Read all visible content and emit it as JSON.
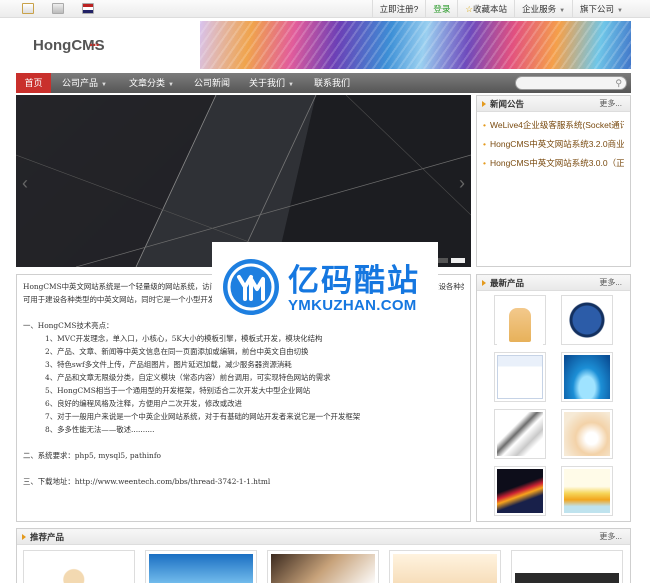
{
  "topbar": {
    "icons": [
      "home-icon",
      "monitor-icon",
      "flag-icon"
    ],
    "links": [
      {
        "label": "立即注册?",
        "color": "#333333"
      },
      {
        "label": "登录",
        "color": "#2a9a2a"
      },
      {
        "label": "收藏本站",
        "color": "#333333"
      },
      {
        "label": "企业服务",
        "dropdown": true
      },
      {
        "label": "旗下公司",
        "dropdown": true
      }
    ]
  },
  "header": {
    "logo_dots": "...",
    "logo_text": "HongCMS"
  },
  "nav": {
    "items": [
      {
        "label": "首页",
        "active": true
      },
      {
        "label": "公司产品",
        "dropdown": true
      },
      {
        "label": "文章分类",
        "dropdown": true
      },
      {
        "label": "公司新闻"
      },
      {
        "label": "关于我们",
        "dropdown": true
      },
      {
        "label": "联系我们"
      }
    ],
    "search_placeholder": ""
  },
  "slider": {
    "prev_icon": "chevron-left-icon",
    "next_icon": "chevron-right-icon",
    "dot_count": 2,
    "active_dot": 2
  },
  "news": {
    "title": "新闻公告",
    "more": "更多...",
    "items": [
      "WeLive4企业级客服系统(Socket通讯技",
      "HongCMS中英文网站系统3.2.0商业版发",
      "HongCMS中英文网站系统3.0.0（正式"
    ]
  },
  "intro": {
    "lines": [
      {
        "text": "HongCMS中英文网站系统是一个轻量级的网站系统，访问速度极快，使用简单。程序代码简洁严谨，完全免费开源。可用于建设各种类型的中英文网站，同时它是一个小型开发框架。",
        "indent": false
      },
      {
        "text": "可用于建设各种类型的中英文网站，同时它是一个小型开发框架。",
        "indent": false
      },
      {
        "text": "",
        "indent": false
      },
      {
        "text": "一、HongCMS技术亮点：",
        "indent": false
      },
      {
        "text": "1、MVC开发理念，单入口，小核心，5K大小的模板引擎，模板式开发，模块化结构",
        "indent": true
      },
      {
        "text": "2、产品、文章、新闻等中英文信息在同一页面添加或编辑，前台中英文自由切换",
        "indent": true
      },
      {
        "text": "3、特色swf多文件上传，产品组图片，图片延迟加载，减少服务器资源消耗",
        "indent": true
      },
      {
        "text": "4、产品和文章无限级分类，自定义模块（常态内容）前台调用，可实现特色网站的需求",
        "indent": true
      },
      {
        "text": "5、HongCMS相当于一个通用型的开发框架，特别适合二次开发大中型企业网站",
        "indent": true
      },
      {
        "text": "6、良好的编程风格及注释，方便用户二次开发，修改或改进",
        "indent": true
      },
      {
        "text": "7、对于一般用户来说是一个中英企业网站系统，对于有基础的网站开发者来说它是一个开发框架",
        "indent": true
      },
      {
        "text": "8、多多性能无法——敬述..........",
        "indent": true
      },
      {
        "text": "",
        "indent": false
      },
      {
        "text": "二、系统要求：php5, mysql5, pathinfo",
        "indent": false
      },
      {
        "text": "",
        "indent": false
      },
      {
        "text": "三、下载地址：http://www.weentech.com/bbs/thread-3742-1-1.html",
        "indent": false
      }
    ]
  },
  "products": {
    "title": "最新产品",
    "more": "更多..."
  },
  "recommended": {
    "title": "推荐产品",
    "more": "更多..."
  },
  "watermark": {
    "cn": "亿码酷站",
    "en": "YMKUZHAN.COM"
  },
  "colors": {
    "accent_red": "#c9302c",
    "nav_gray": "#666666",
    "bullet_orange": "#e49a1e",
    "watermark_blue": "#1577e0"
  }
}
